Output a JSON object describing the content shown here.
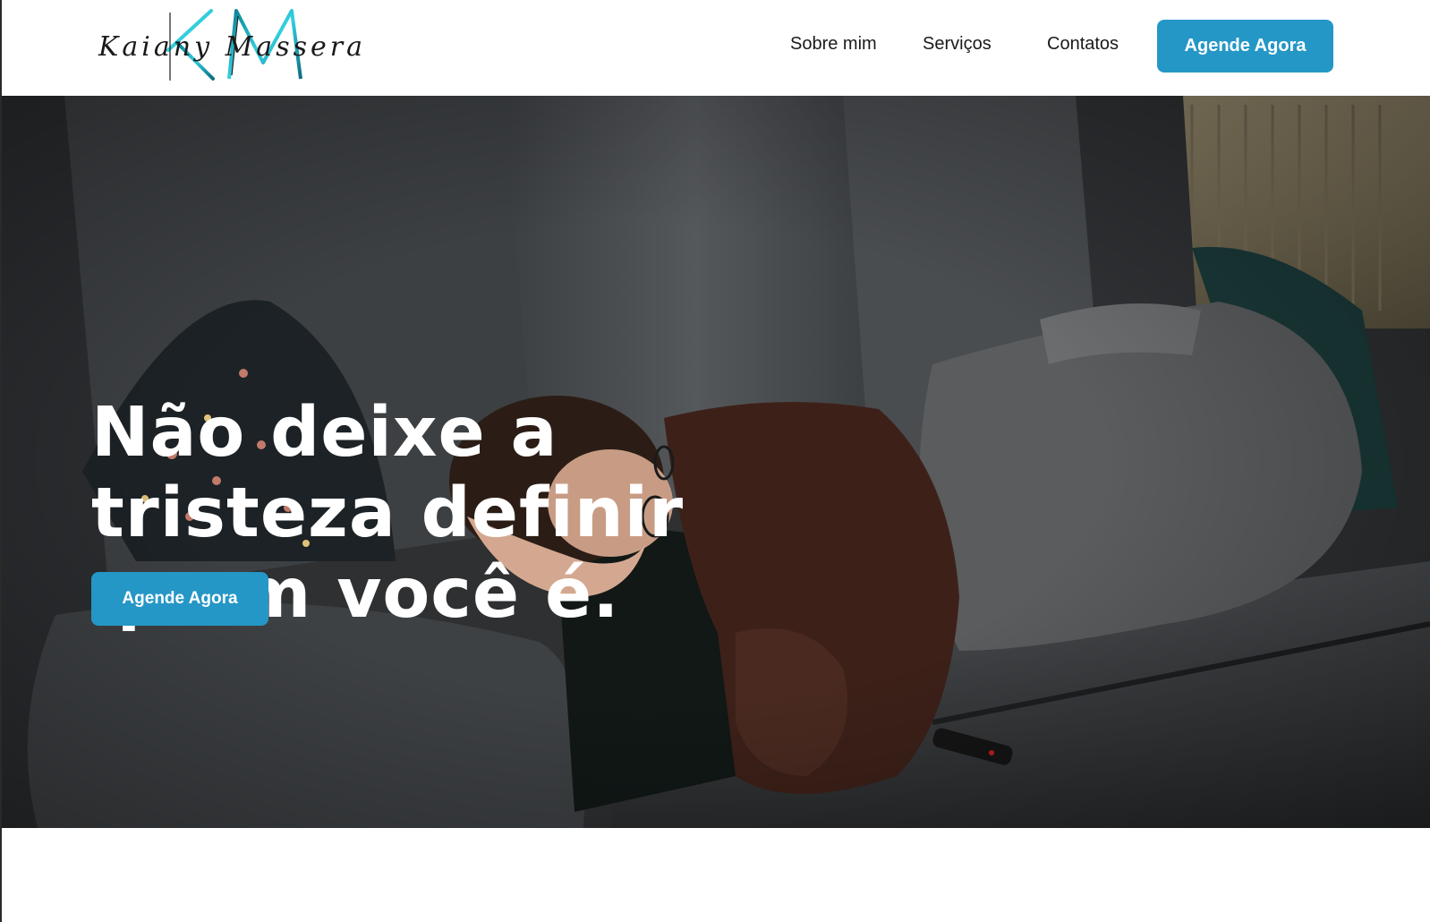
{
  "header": {
    "logo": {
      "monogram": "KM",
      "script_text": "Kaiany Massera",
      "icon": "km-logo-icon"
    },
    "nav": [
      {
        "label": "Sobre mim"
      },
      {
        "label": "Serviços"
      },
      {
        "label": "Contatos"
      }
    ],
    "cta_label": "Agende Agora"
  },
  "hero": {
    "title": "Não deixe a\ntristeza definir\nquem você é.",
    "cta_label": "Agende Agora",
    "image": "person-sleeping-on-sofa-photo"
  },
  "colors": {
    "accent": "#2597c6",
    "logo_teal": "#1fb8c9",
    "text": "#1a1a1a"
  }
}
